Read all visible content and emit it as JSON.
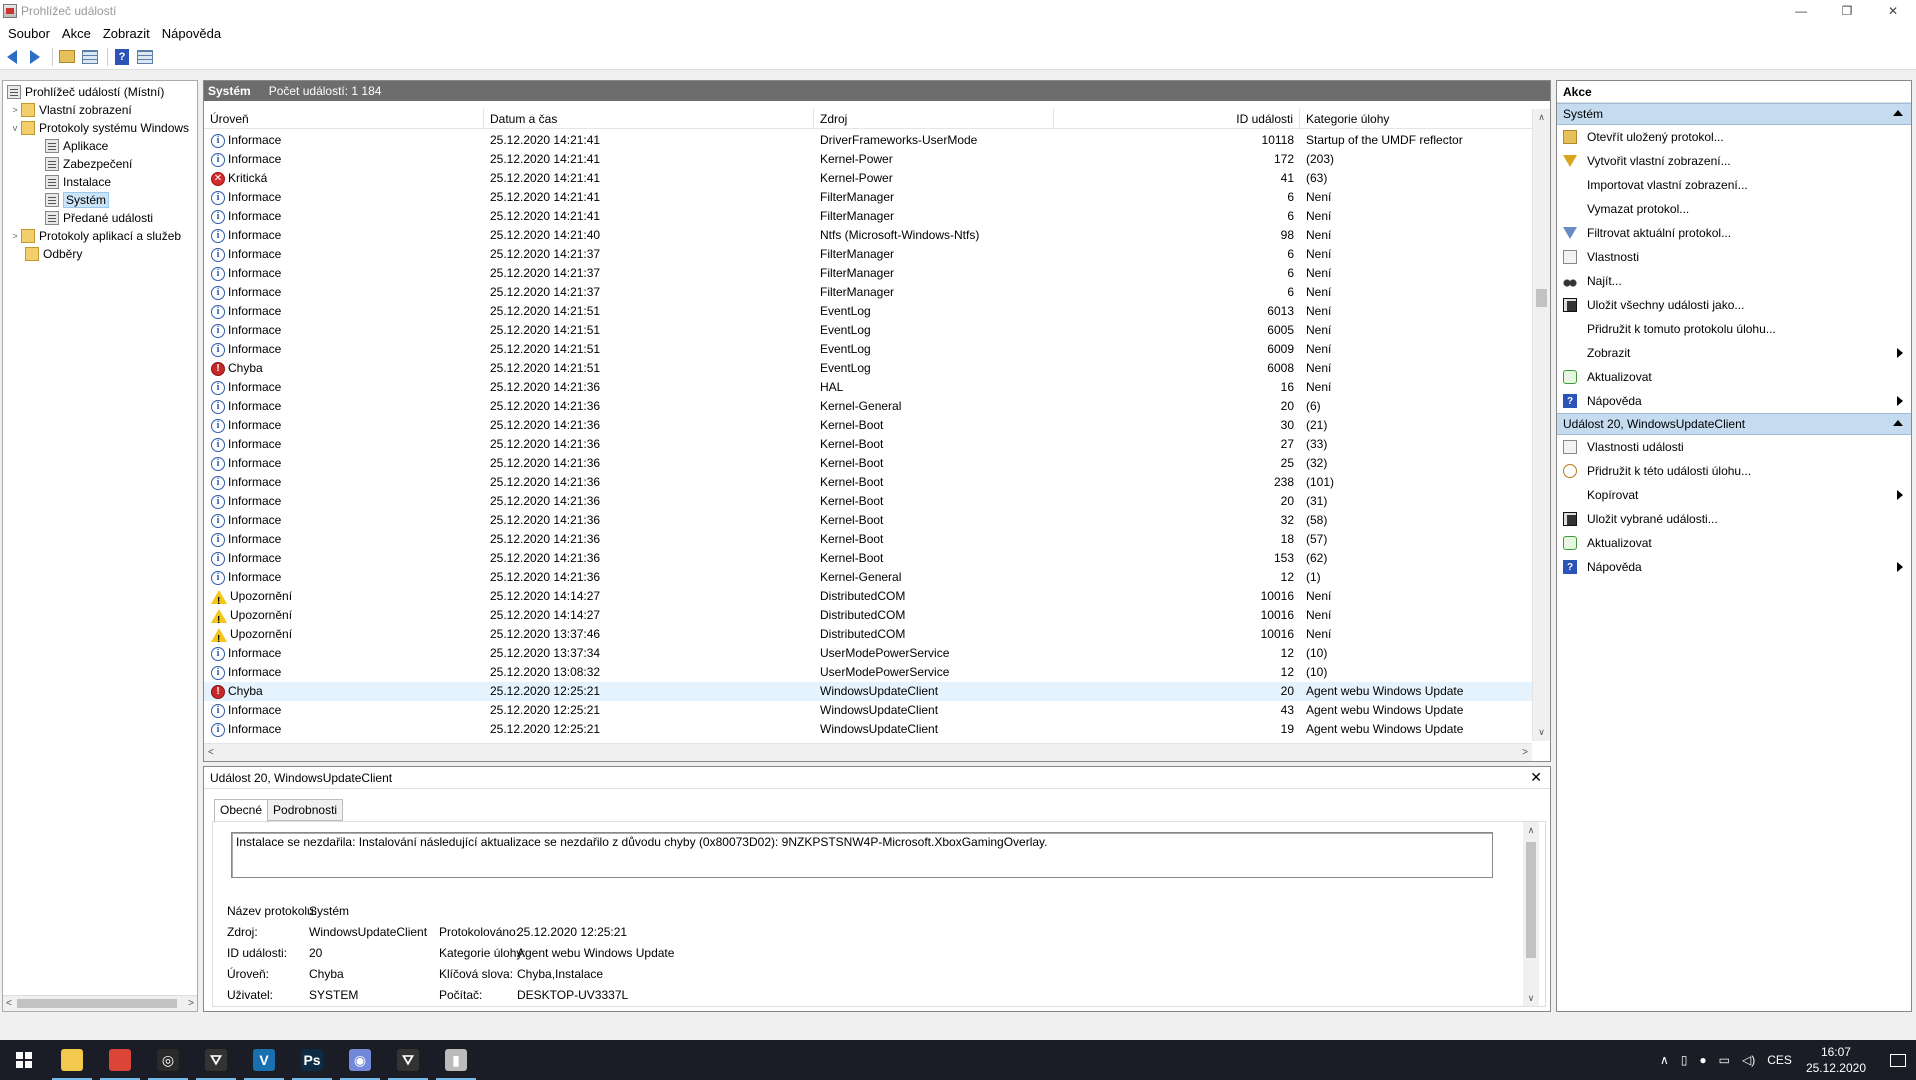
{
  "window": {
    "title": "Prohlížeč událostí",
    "minimize": "—",
    "restore": "❐",
    "close": "✕"
  },
  "menu": [
    "Soubor",
    "Akce",
    "Zobrazit",
    "Nápověda"
  ],
  "tree": {
    "root": "Prohlížeč událostí (Místní)",
    "custom_views": "Vlastní zobrazení",
    "windows_logs": "Protokoly systému Windows",
    "apps": "Aplikace",
    "security": "Zabezpečení",
    "setup": "Instalace",
    "system": "Systém",
    "forwarded": "Předané události",
    "app_service_logs": "Protokoly aplikací a služeb",
    "subscriptions": "Odběry"
  },
  "list": {
    "title": "Systém",
    "count": "Počet událostí: 1 184",
    "columns": {
      "level": "Úroveň",
      "date": "Datum a čas",
      "source": "Zdroj",
      "id": "ID události",
      "category": "Kategorie úlohy"
    },
    "rows": [
      {
        "level": "Informace",
        "type": "info",
        "date": "25.12.2020 14:21:41",
        "source": "DriverFrameworks-UserMode",
        "id": "10118",
        "category": "Startup of the UMDF reflector"
      },
      {
        "level": "Informace",
        "type": "info",
        "date": "25.12.2020 14:21:41",
        "source": "Kernel-Power",
        "id": "172",
        "category": "(203)"
      },
      {
        "level": "Kritická",
        "type": "crit",
        "date": "25.12.2020 14:21:41",
        "source": "Kernel-Power",
        "id": "41",
        "category": "(63)"
      },
      {
        "level": "Informace",
        "type": "info",
        "date": "25.12.2020 14:21:41",
        "source": "FilterManager",
        "id": "6",
        "category": "Není"
      },
      {
        "level": "Informace",
        "type": "info",
        "date": "25.12.2020 14:21:41",
        "source": "FilterManager",
        "id": "6",
        "category": "Není"
      },
      {
        "level": "Informace",
        "type": "info",
        "date": "25.12.2020 14:21:40",
        "source": "Ntfs (Microsoft-Windows-Ntfs)",
        "id": "98",
        "category": "Není"
      },
      {
        "level": "Informace",
        "type": "info",
        "date": "25.12.2020 14:21:37",
        "source": "FilterManager",
        "id": "6",
        "category": "Není"
      },
      {
        "level": "Informace",
        "type": "info",
        "date": "25.12.2020 14:21:37",
        "source": "FilterManager",
        "id": "6",
        "category": "Není"
      },
      {
        "level": "Informace",
        "type": "info",
        "date": "25.12.2020 14:21:37",
        "source": "FilterManager",
        "id": "6",
        "category": "Není"
      },
      {
        "level": "Informace",
        "type": "info",
        "date": "25.12.2020 14:21:51",
        "source": "EventLog",
        "id": "6013",
        "category": "Není"
      },
      {
        "level": "Informace",
        "type": "info",
        "date": "25.12.2020 14:21:51",
        "source": "EventLog",
        "id": "6005",
        "category": "Není"
      },
      {
        "level": "Informace",
        "type": "info",
        "date": "25.12.2020 14:21:51",
        "source": "EventLog",
        "id": "6009",
        "category": "Není"
      },
      {
        "level": "Chyba",
        "type": "err",
        "date": "25.12.2020 14:21:51",
        "source": "EventLog",
        "id": "6008",
        "category": "Není"
      },
      {
        "level": "Informace",
        "type": "info",
        "date": "25.12.2020 14:21:36",
        "source": "HAL",
        "id": "16",
        "category": "Není"
      },
      {
        "level": "Informace",
        "type": "info",
        "date": "25.12.2020 14:21:36",
        "source": "Kernel-General",
        "id": "20",
        "category": "(6)"
      },
      {
        "level": "Informace",
        "type": "info",
        "date": "25.12.2020 14:21:36",
        "source": "Kernel-Boot",
        "id": "30",
        "category": "(21)"
      },
      {
        "level": "Informace",
        "type": "info",
        "date": "25.12.2020 14:21:36",
        "source": "Kernel-Boot",
        "id": "27",
        "category": "(33)"
      },
      {
        "level": "Informace",
        "type": "info",
        "date": "25.12.2020 14:21:36",
        "source": "Kernel-Boot",
        "id": "25",
        "category": "(32)"
      },
      {
        "level": "Informace",
        "type": "info",
        "date": "25.12.2020 14:21:36",
        "source": "Kernel-Boot",
        "id": "238",
        "category": "(101)"
      },
      {
        "level": "Informace",
        "type": "info",
        "date": "25.12.2020 14:21:36",
        "source": "Kernel-Boot",
        "id": "20",
        "category": "(31)"
      },
      {
        "level": "Informace",
        "type": "info",
        "date": "25.12.2020 14:21:36",
        "source": "Kernel-Boot",
        "id": "32",
        "category": "(58)"
      },
      {
        "level": "Informace",
        "type": "info",
        "date": "25.12.2020 14:21:36",
        "source": "Kernel-Boot",
        "id": "18",
        "category": "(57)"
      },
      {
        "level": "Informace",
        "type": "info",
        "date": "25.12.2020 14:21:36",
        "source": "Kernel-Boot",
        "id": "153",
        "category": "(62)"
      },
      {
        "level": "Informace",
        "type": "info",
        "date": "25.12.2020 14:21:36",
        "source": "Kernel-General",
        "id": "12",
        "category": "(1)"
      },
      {
        "level": "Upozornění",
        "type": "warn",
        "date": "25.12.2020 14:14:27",
        "source": "DistributedCOM",
        "id": "10016",
        "category": "Není"
      },
      {
        "level": "Upozornění",
        "type": "warn",
        "date": "25.12.2020 14:14:27",
        "source": "DistributedCOM",
        "id": "10016",
        "category": "Není"
      },
      {
        "level": "Upozornění",
        "type": "warn",
        "date": "25.12.2020 13:37:46",
        "source": "DistributedCOM",
        "id": "10016",
        "category": "Není"
      },
      {
        "level": "Informace",
        "type": "info",
        "date": "25.12.2020 13:37:34",
        "source": "UserModePowerService",
        "id": "12",
        "category": "(10)"
      },
      {
        "level": "Informace",
        "type": "info",
        "date": "25.12.2020 13:08:32",
        "source": "UserModePowerService",
        "id": "12",
        "category": "(10)"
      },
      {
        "level": "Chyba",
        "type": "err",
        "date": "25.12.2020 12:25:21",
        "source": "WindowsUpdateClient",
        "id": "20",
        "category": "Agent webu Windows Update",
        "selected": true
      },
      {
        "level": "Informace",
        "type": "info",
        "date": "25.12.2020 12:25:21",
        "source": "WindowsUpdateClient",
        "id": "43",
        "category": "Agent webu Windows Update"
      },
      {
        "level": "Informace",
        "type": "info",
        "date": "25.12.2020 12:25:21",
        "source": "WindowsUpdateClient",
        "id": "19",
        "category": "Agent webu Windows Update"
      }
    ]
  },
  "detail": {
    "title": "Událost 20, WindowsUpdateClient",
    "tab_general": "Obecné",
    "tab_details": "Podrobnosti",
    "description": "Instalace se nezdařila: Instalování následující aktualizace se nezdařilo z důvodu chyby (0x80073D02): 9NZKPSTSNW4P-Microsoft.XboxGamingOverlay.",
    "labels": {
      "log_name": "Název protokolu:",
      "source": "Zdroj:",
      "event_id": "ID události:",
      "level": "Úroveň:",
      "user": "Uživatel:",
      "logged": "Protokolováno:",
      "task_category": "Kategorie úlohy:",
      "keywords": "Klíčová slova:",
      "computer": "Počítač:"
    },
    "values": {
      "log_name": "Systém",
      "source": "WindowsUpdateClient",
      "event_id": "20",
      "level": "Chyba",
      "user": "SYSTEM",
      "logged": "25.12.2020 12:25:21",
      "task_category": "Agent webu Windows Update",
      "keywords": "Chyba,Instalace",
      "computer": "DESKTOP-UV3337L"
    }
  },
  "actions": {
    "title": "Akce",
    "section_system": "Systém",
    "system_items": [
      {
        "label": "Otevřít uložený protokol...",
        "icon": "folder"
      },
      {
        "label": "Vytvořit vlastní zobrazení...",
        "icon": "filter"
      },
      {
        "label": "Importovat vlastní zobrazení...",
        "icon": "none"
      },
      {
        "label": "Vymazat protokol...",
        "icon": "none"
      },
      {
        "label": "Filtrovat aktuální protokol...",
        "icon": "filter-b"
      },
      {
        "label": "Vlastnosti",
        "icon": "doc"
      },
      {
        "label": "Najít...",
        "icon": "find"
      },
      {
        "label": "Uložit všechny události jako...",
        "icon": "save"
      },
      {
        "label": "Přidružit k tomuto protokolu úlohu...",
        "icon": "none"
      },
      {
        "label": "Zobrazit",
        "icon": "none",
        "submenu": true
      },
      {
        "label": "Aktualizovat",
        "icon": "refresh"
      },
      {
        "label": "Nápověda",
        "icon": "help",
        "submenu": true
      }
    ],
    "section_event": "Událost 20, WindowsUpdateClient",
    "event_items": [
      {
        "label": "Vlastnosti události",
        "icon": "doc"
      },
      {
        "label": "Přidružit k této události úlohu...",
        "icon": "task"
      },
      {
        "label": "Kopírovat",
        "icon": "none",
        "submenu": true
      },
      {
        "label": "Uložit vybrané události...",
        "icon": "save"
      },
      {
        "label": "Aktualizovat",
        "icon": "refresh"
      },
      {
        "label": "Nápověda",
        "icon": "help",
        "submenu": true
      }
    ]
  },
  "taskbar": {
    "apps": [
      {
        "name": "file-explorer",
        "glyph": "",
        "color": "#f2c94c"
      },
      {
        "name": "chrome",
        "glyph": "",
        "color": "#db4437"
      },
      {
        "name": "steam",
        "glyph": "◎",
        "color": "#2a2a2a"
      },
      {
        "name": "game-1",
        "glyph": "⛛",
        "color": "#333"
      },
      {
        "name": "vivaldi",
        "glyph": "V",
        "color": "#1a6fb0"
      },
      {
        "name": "photoshop",
        "glyph": "Ps",
        "color": "#0f2a44"
      },
      {
        "name": "discord",
        "glyph": "◉",
        "color": "#7289da"
      },
      {
        "name": "game-2",
        "glyph": "⛛",
        "color": "#333"
      },
      {
        "name": "event-viewer",
        "glyph": "▮",
        "color": "#bbb"
      }
    ],
    "language": "CES",
    "time": "16:07",
    "date": "25.12.2020"
  }
}
